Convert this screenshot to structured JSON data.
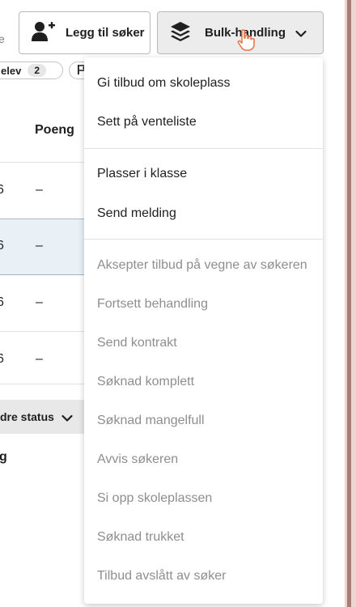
{
  "left_cut_text": "e",
  "toolbar": {
    "add_label": "Legg til søker",
    "add_icon": "person-add-icon",
    "bulk_label": "Bulk-handling",
    "bulk_icon": "layers-icon"
  },
  "filters": {
    "elev_label": "elev",
    "elev_count": "2"
  },
  "table": {
    "column_header": "Poeng",
    "rows": [
      {
        "left": "6",
        "poeng": "–"
      },
      {
        "left": "6",
        "poeng": "–"
      },
      {
        "left": "6",
        "poeng": "–"
      },
      {
        "left": "6",
        "poeng": "–"
      }
    ]
  },
  "status_button_label": "dre status",
  "cut_bottom_text": "g",
  "bulk_menu": {
    "group1": [
      "Gi tilbud om skoleplass",
      "Sett på venteliste"
    ],
    "group2": [
      "Plasser i klasse",
      "Send melding"
    ],
    "group3_disabled": [
      "Aksepter tilbud på vegne av søkeren",
      "Fortsett behandling",
      "Send kontrakt",
      "Søknad komplett",
      "Søknad mangelfull",
      "Avvis søkeren",
      "Si opp skoleplassen",
      "Søknad trukket",
      "Tilbud avslått av søker"
    ]
  },
  "colors": {
    "selected_row": "#e9f0f6",
    "disabled_text": "#8e8e8e",
    "cursor_accent": "#e8794f"
  }
}
